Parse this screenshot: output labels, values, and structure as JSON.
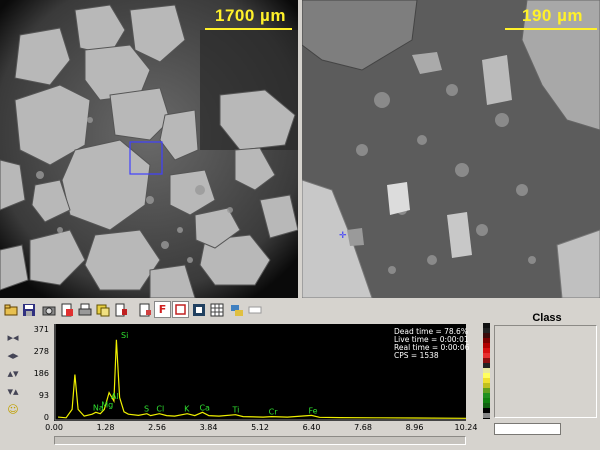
{
  "images": {
    "left": {
      "scale_label": "1700 µm"
    },
    "right": {
      "scale_label": "190 µm"
    }
  },
  "toolbar": {
    "buttons": [
      "open-icon",
      "save-icon",
      "camera-icon",
      "print-preview-icon",
      "print-icon",
      "copy-image-icon",
      "export-icon",
      "copy-data-icon",
      "report-icon",
      "fit-icon",
      "stop-icon",
      "grid-icon",
      "settings-icon",
      "blank-icon"
    ]
  },
  "spectrum": {
    "y_ticks": [
      "371",
      "278",
      "186",
      "93",
      "0"
    ],
    "x_ticks": [
      "0.00",
      "1.28",
      "2.56",
      "3.84",
      "5.12",
      "6.40",
      "7.68",
      "8.96",
      "10.24"
    ],
    "stats": [
      "Dead time = 78.6%",
      "Live time = 0:00:01",
      "Real time = 0:00:06",
      "CPS = 1538"
    ],
    "peak_labels": [
      "Si",
      "Al",
      "Na",
      "Mg",
      "S",
      "Cl",
      "K",
      "Ca",
      "Ti",
      "Cr",
      "Fe"
    ]
  },
  "chart_data": {
    "type": "line",
    "title": "",
    "xlabel": "",
    "ylabel": "",
    "xlim": [
      0,
      10.24
    ],
    "ylim": [
      0,
      371
    ],
    "x": [
      0.1,
      0.3,
      0.45,
      0.52,
      0.6,
      0.75,
      0.95,
      1.04,
      1.15,
      1.25,
      1.37,
      1.49,
      1.55,
      1.63,
      1.74,
      1.85,
      2.1,
      2.31,
      2.4,
      2.62,
      2.8,
      3.0,
      3.31,
      3.5,
      3.69,
      3.85,
      4.1,
      4.51,
      4.7,
      5.2,
      5.41,
      5.8,
      6.4,
      6.6,
      7.1,
      8.0,
      9.0,
      10.24
    ],
    "series": [
      {
        "values": [
          8,
          5,
          40,
          185,
          40,
          12,
          20,
          28,
          22,
          40,
          110,
          75,
          330,
          90,
          30,
          20,
          15,
          22,
          14,
          22,
          14,
          12,
          22,
          14,
          28,
          14,
          12,
          18,
          10,
          8,
          10,
          8,
          15,
          7,
          6,
          5,
          4,
          3
        ]
      }
    ]
  },
  "colorbar": [
    "#111111",
    "#222222",
    "#3a0a0a",
    "#7a0000",
    "#b00000",
    "#d81010",
    "#e83030",
    "#8a1010",
    "#222222",
    "#e8e8a0",
    "#ffff60",
    "#f0e030",
    "#c0c020",
    "#60a020",
    "#209020",
    "#108010",
    "#106010",
    "#000000",
    "#888888"
  ],
  "class_panel": {
    "title": "Class",
    "input_value": ""
  },
  "left_controls": [
    "zoom-in-icon",
    "zoom-out-icon",
    "scroll-up-icon",
    "scroll-down-icon",
    "smiley-icon"
  ]
}
